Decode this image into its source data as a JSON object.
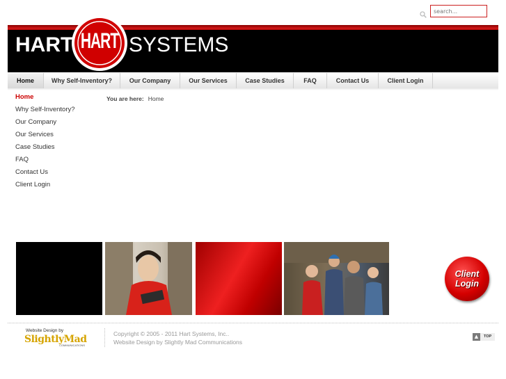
{
  "search": {
    "placeholder": "search..."
  },
  "logo": {
    "left": "HART",
    "seal": "HART",
    "right": "SYSTEMS"
  },
  "nav": {
    "items": [
      {
        "label": "Home"
      },
      {
        "label": "Why Self-Inventory?"
      },
      {
        "label": "Our Company"
      },
      {
        "label": "Our Services"
      },
      {
        "label": "Case Studies"
      },
      {
        "label": "FAQ"
      },
      {
        "label": "Contact Us"
      },
      {
        "label": "Client Login"
      }
    ]
  },
  "sidebar": {
    "items": [
      {
        "label": "Home"
      },
      {
        "label": "Why Self-Inventory?"
      },
      {
        "label": "Our Company"
      },
      {
        "label": "Our Services"
      },
      {
        "label": "Case Studies"
      },
      {
        "label": "FAQ"
      },
      {
        "label": "Contact Us"
      },
      {
        "label": "Client Login"
      }
    ]
  },
  "breadcrumb": {
    "label": "You are here:",
    "current": "Home"
  },
  "client_login": {
    "line1": "Client",
    "line2": "Login"
  },
  "footer": {
    "logo_small": "Website Design by",
    "logo_big": "SlightlyMad",
    "logo_sub": "COMMUNICATIONS",
    "copyright": "Copyright © 2005 - 2011 Hart Systems, Inc..",
    "design": "Website Design by Slightly Mad Communications",
    "top_label": "TOP"
  },
  "colors": {
    "brand_red": "#cc0000",
    "banner": "#000000"
  }
}
